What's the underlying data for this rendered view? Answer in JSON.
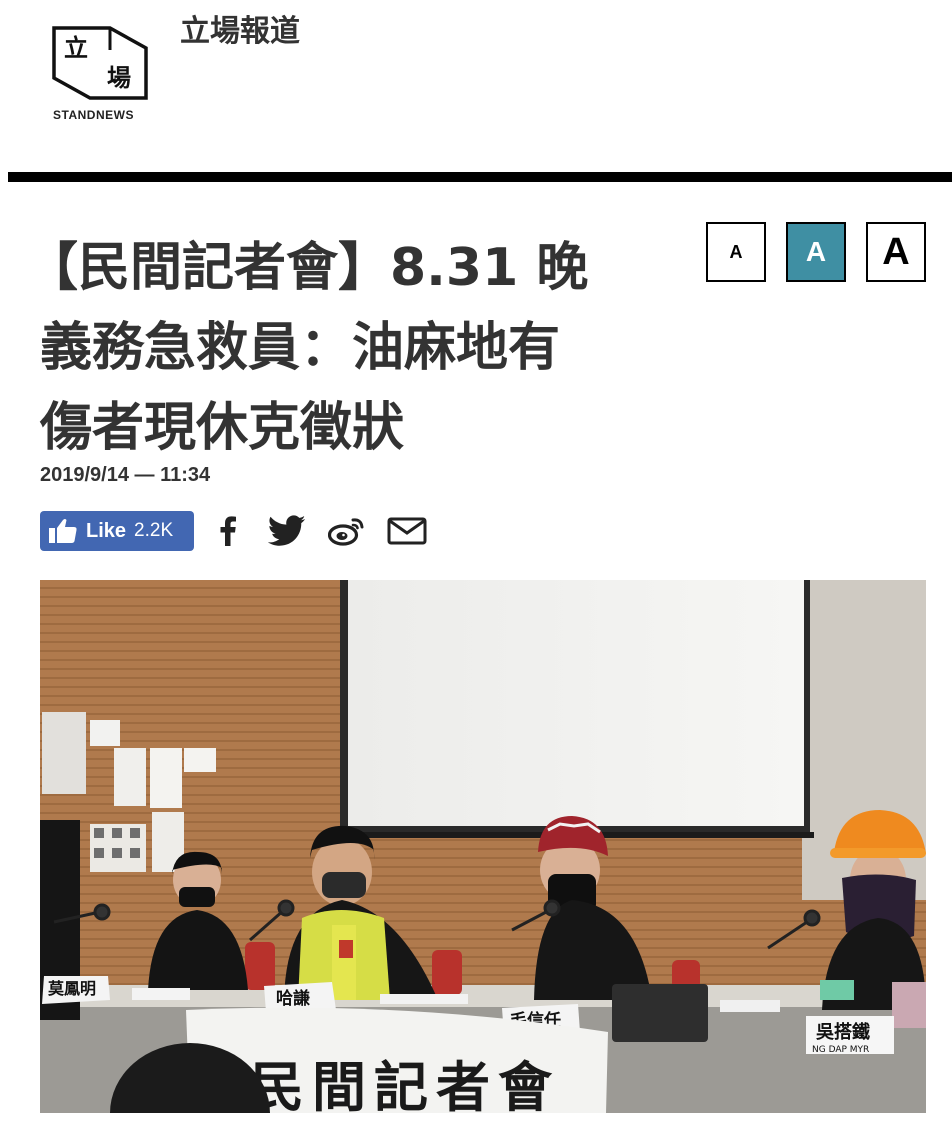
{
  "header": {
    "logo_char_1": "立",
    "logo_char_2": "場",
    "logo_text": "STANDNEWS",
    "site_name": "立場報道"
  },
  "font_controls": {
    "small": "A",
    "medium": "A",
    "large": "A",
    "selected": "medium",
    "accent_color": "#3f8fa3"
  },
  "article": {
    "title_lines": [
      "【民間記者會】8.31 晚",
      "義務急救員：油麻地有",
      "傷者現休克徵狀"
    ],
    "dateline": "2019/9/14 — 11:34"
  },
  "share": {
    "like_label": "Like",
    "like_count": "2.2K",
    "like_color": "#4267b2",
    "icons": [
      "facebook-icon",
      "twitter-icon",
      "weibo-icon",
      "mail-icon"
    ]
  },
  "photo": {
    "banner_text": "民間記者會",
    "name_cards": [
      "莫鳳明",
      "哈謙",
      "毛信任",
      "吳搭鐵"
    ],
    "name_card_subtitle": "NG DAP MYR"
  }
}
